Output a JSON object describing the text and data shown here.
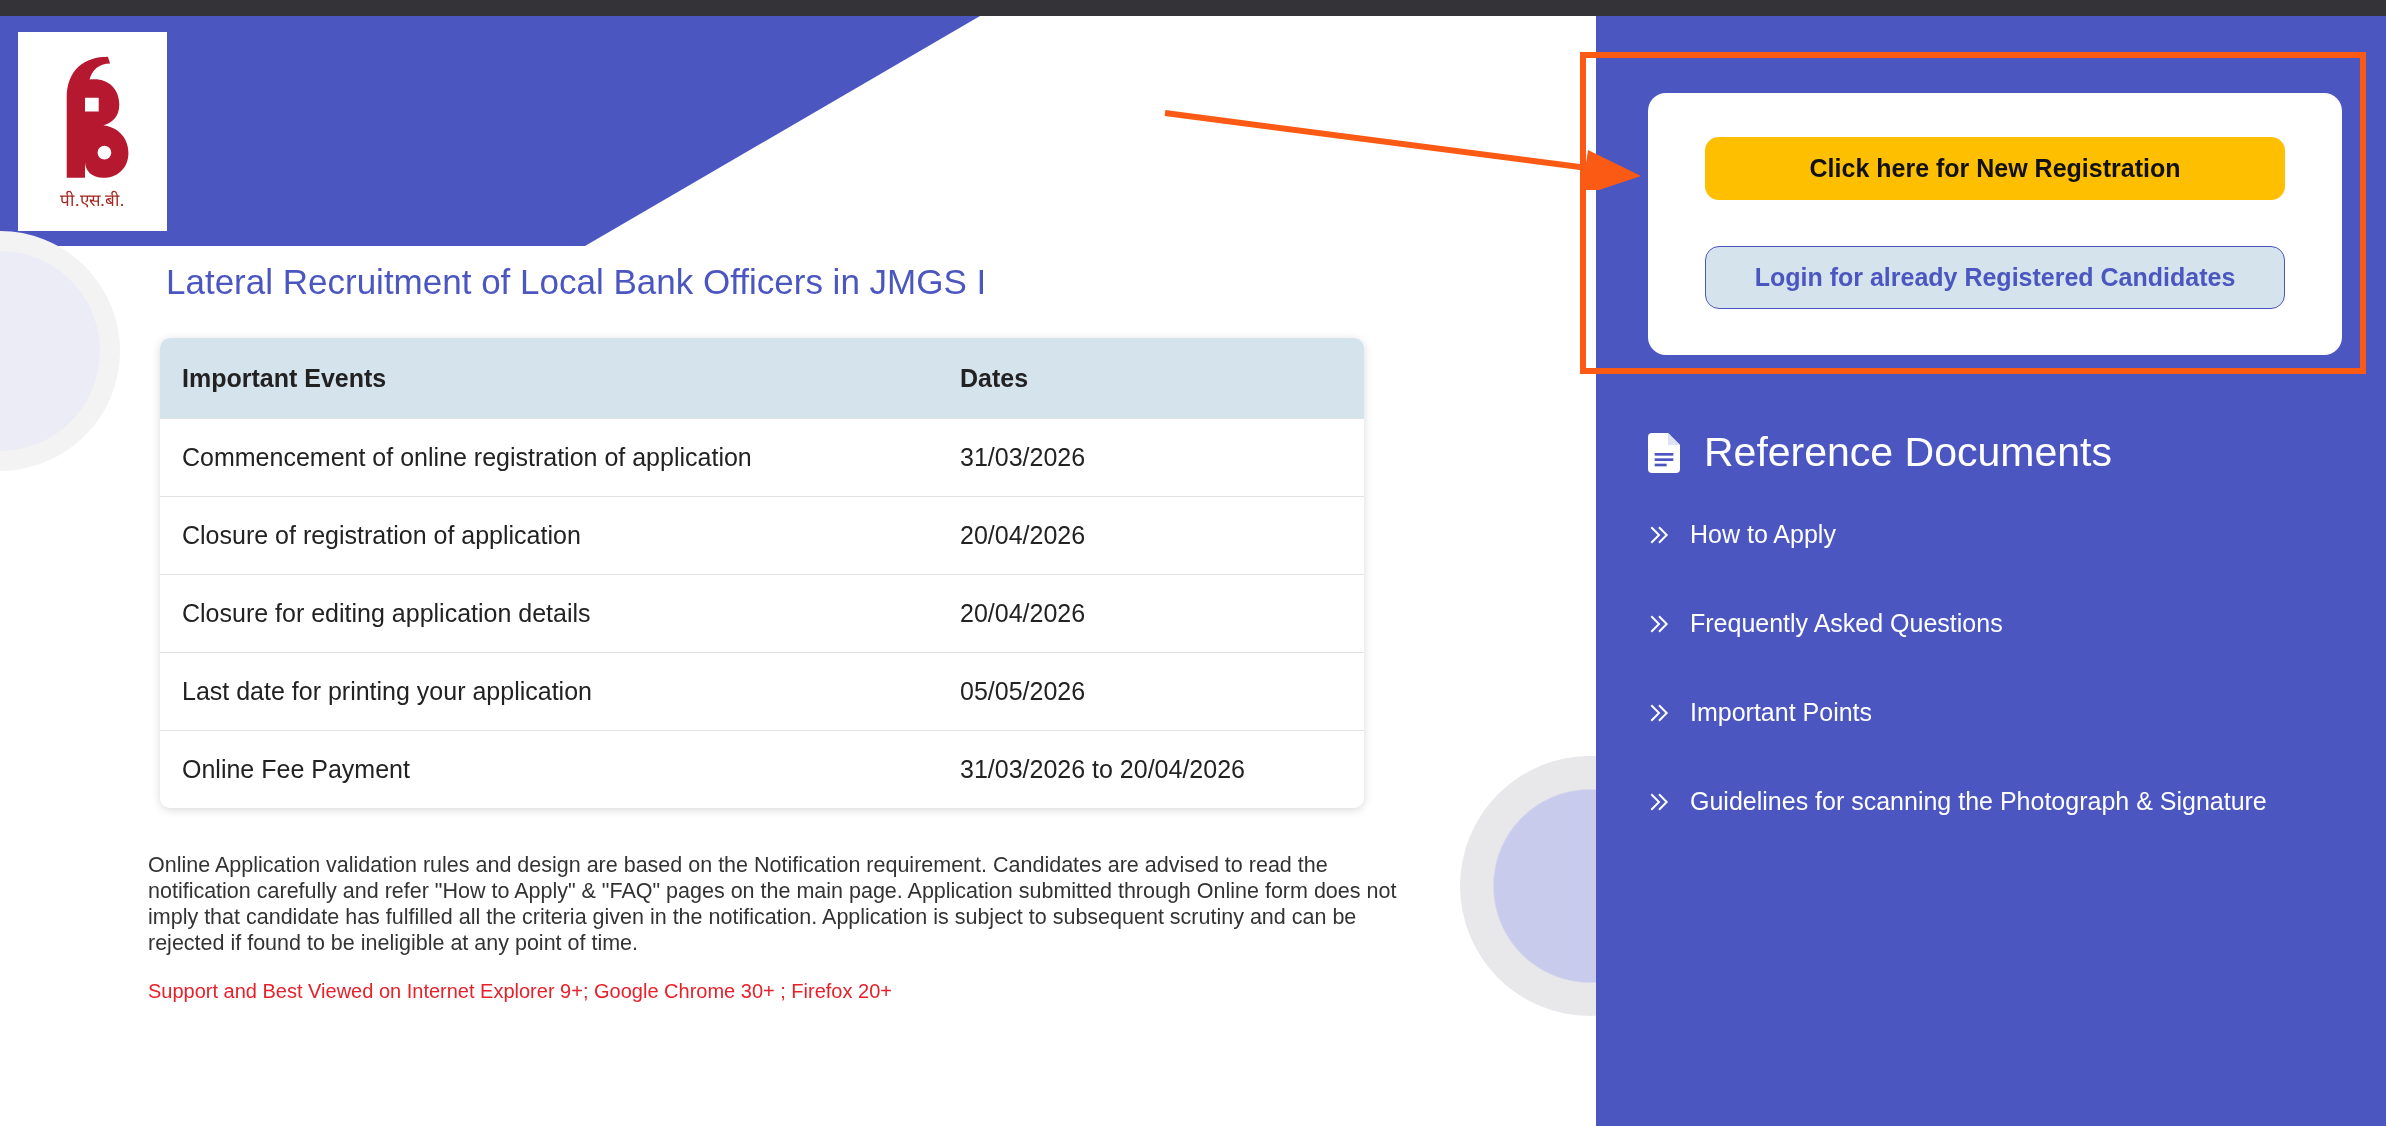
{
  "logo": {
    "caption": "पी.एस.बी."
  },
  "title": "Lateral Recruitment of Local Bank Officers in JMGS I",
  "events_table": {
    "columns": [
      "Important Events",
      "Dates"
    ],
    "rows": [
      {
        "event": "Commencement of online registration of application",
        "date": "31/03/2026"
      },
      {
        "event": "Closure of registration of application",
        "date": "20/04/2026"
      },
      {
        "event": "Closure for editing application details",
        "date": "20/04/2026"
      },
      {
        "event": "Last date for printing your application",
        "date": "05/05/2026"
      },
      {
        "event": "Online Fee Payment",
        "date": "31/03/2026 to 20/04/2026"
      }
    ]
  },
  "notice": "Online Application validation rules and design are based on the Notification requirement. Candidates are advised to read the notification carefully and refer \"How to Apply\" & \"FAQ\" pages on the main page. Application submitted through Online form does not imply that candidate has fulfilled all the criteria given in the notification. Application is subject to subsequent scrutiny and can be rejected if found to be ineligible at any point of time.",
  "browser_note": "Support and Best Viewed on Internet Explorer 9+; Google Chrome 30+ ; Firefox 20+",
  "login_card": {
    "buttons": [
      {
        "label": "Click here for New Registration",
        "kind": "primary"
      },
      {
        "label": "Login for already Registered Candidates",
        "kind": "secondary"
      }
    ]
  },
  "reference_documents": {
    "title": "Reference Documents",
    "items": [
      {
        "label": "How to Apply"
      },
      {
        "label": "Frequently Asked Questions"
      },
      {
        "label": "Important Points"
      },
      {
        "label": "Guidelines for scanning the Photograph & Signature"
      }
    ]
  }
}
